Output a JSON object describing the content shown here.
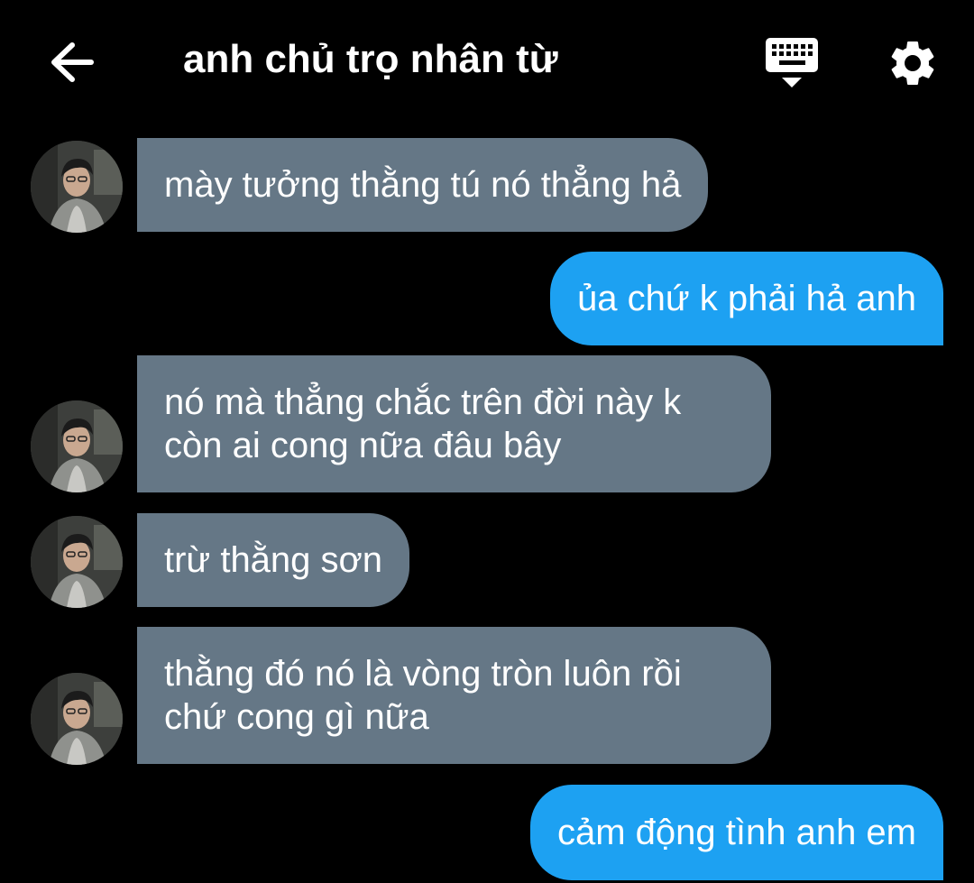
{
  "header": {
    "title": "anh chủ trọ nhân từ",
    "back_icon": "arrow-left-icon",
    "keyboard_icon": "keyboard-icon",
    "settings_icon": "gear-icon"
  },
  "messages": [
    {
      "direction": "incoming",
      "text": "mày tưởng thằng tú nó thẳng hả"
    },
    {
      "direction": "outgoing",
      "text": "ủa chứ k phải hả anh"
    },
    {
      "direction": "incoming",
      "lines": [
        "nó mà thẳng chắc trên đời này k",
        "còn ai cong nữa đâu bây"
      ]
    },
    {
      "direction": "incoming",
      "text": "trừ thằng sơn"
    },
    {
      "direction": "incoming",
      "lines": [
        "thằng đó nó là vòng tròn luôn rồi",
        "chứ cong gì nữa"
      ]
    },
    {
      "direction": "outgoing",
      "text": "cảm động tình anh em"
    }
  ],
  "colors": {
    "background": "#000000",
    "incoming_bubble": "#657786",
    "outgoing_bubble": "#1da1f2",
    "text": "#ffffff"
  }
}
